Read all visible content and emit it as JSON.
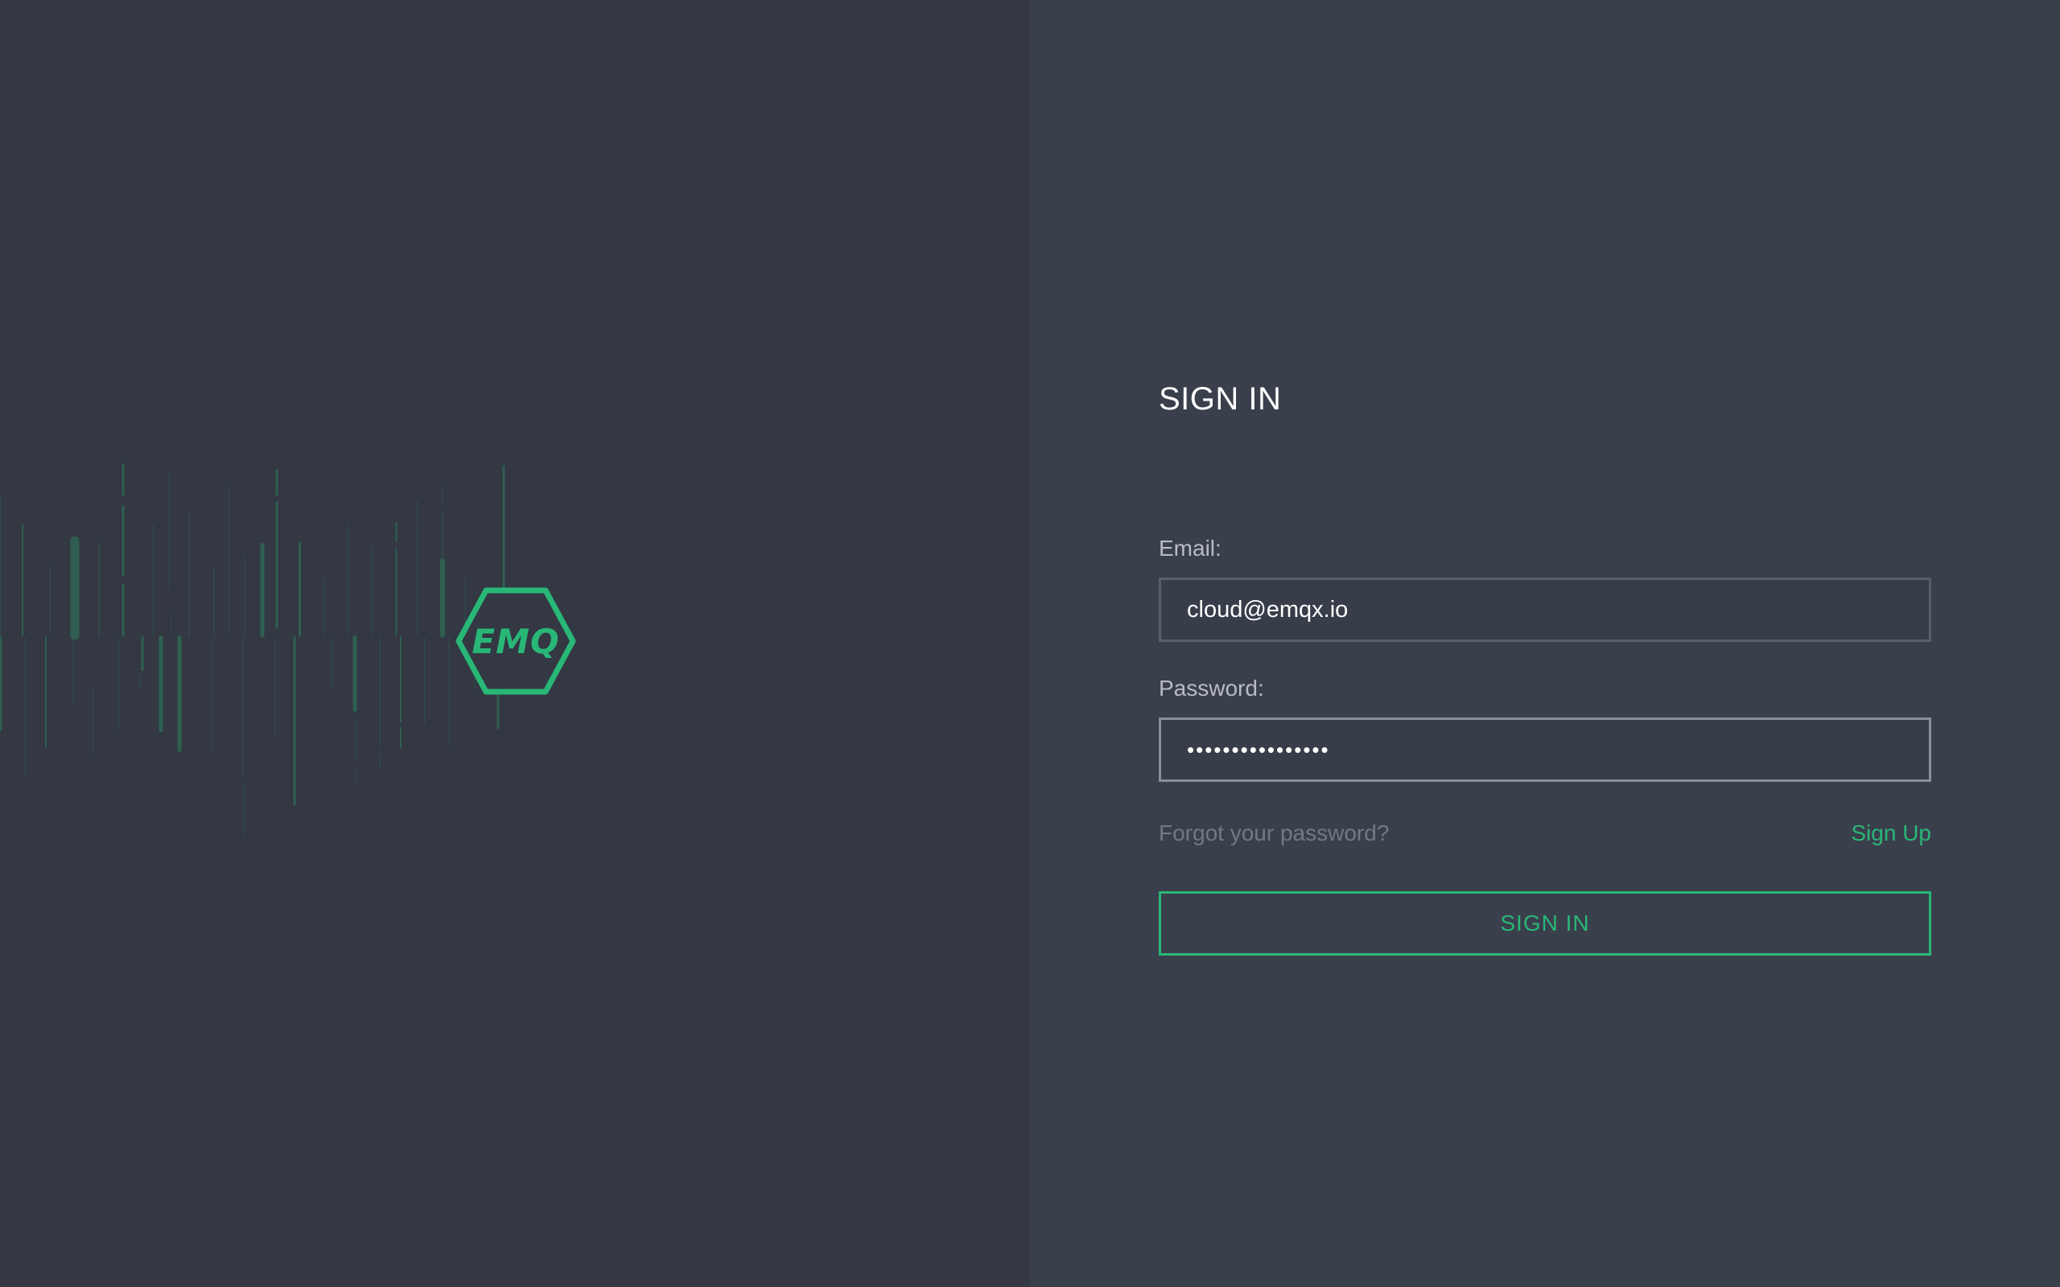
{
  "colors": {
    "left_background": "#333843",
    "right_background": "#3a3f4c",
    "accent": "#29b777",
    "line": "#2f6552",
    "label": "#b8bcc4",
    "muted_link": "#737887"
  },
  "brand": {
    "logo_text": "EMQ",
    "logo_icon": "hexagon-logo-icon"
  },
  "form": {
    "title": "SIGN IN",
    "email_label": "Email:",
    "email_value": "cloud@emqx.io",
    "password_label": "Password:",
    "password_value": "••••••••••••••••",
    "forgot_link": "Forgot your password?",
    "signup_link": "Sign Up",
    "submit_label": "SIGN IN"
  }
}
